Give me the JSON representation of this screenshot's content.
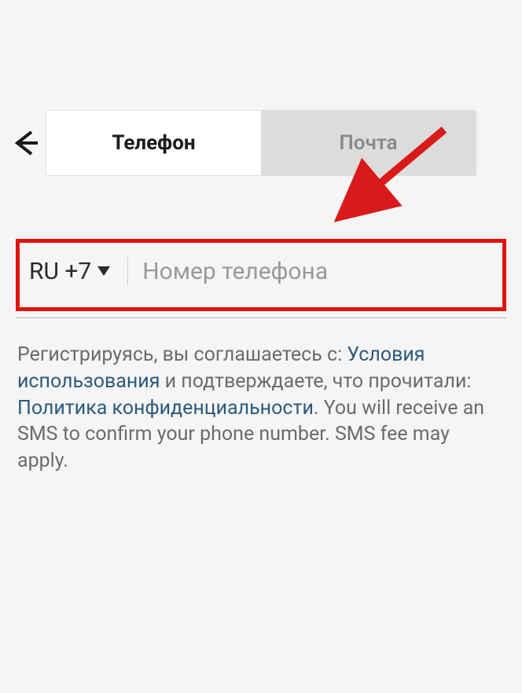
{
  "header": {
    "back_icon": "back-arrow-icon"
  },
  "tabs": {
    "phone_label": "Телефон",
    "email_label": "Почта"
  },
  "phone_input": {
    "country_code": "RU +7",
    "placeholder": "Номер телефона"
  },
  "legal": {
    "part1": "Регистрируясь, вы соглашаетесь с: ",
    "terms_link": "Условия использования",
    "part2": " и подтверждаете, что прочитали: ",
    "privacy_link": "Политика конфиденциальности",
    "part3": ". You will receive an SMS to confirm your phone number. SMS fee may apply."
  }
}
